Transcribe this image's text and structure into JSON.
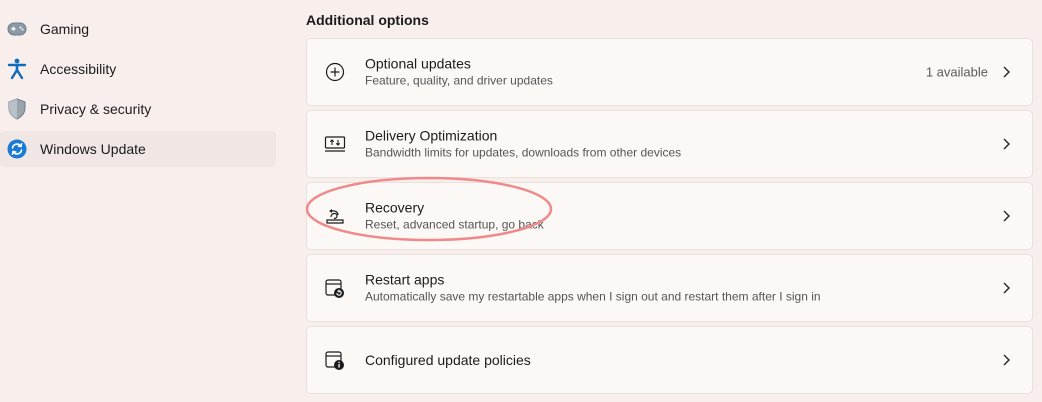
{
  "sidebar": {
    "items": [
      {
        "label": "Gaming",
        "icon": "gamepad-icon"
      },
      {
        "label": "Accessibility",
        "icon": "accessibility-icon"
      },
      {
        "label": "Privacy & security",
        "icon": "shield-icon"
      },
      {
        "label": "Windows Update",
        "icon": "windows-update-icon",
        "selected": true
      }
    ]
  },
  "main": {
    "section_title": "Additional options",
    "cards": [
      {
        "title": "Optional updates",
        "subtitle": "Feature, quality, and driver updates",
        "status": "1 available",
        "icon": "plus-circle-icon"
      },
      {
        "title": "Delivery Optimization",
        "subtitle": "Bandwidth limits for updates, downloads from other devices",
        "icon": "delivery-optimization-icon"
      },
      {
        "title": "Recovery",
        "subtitle": "Reset, advanced startup, go back",
        "icon": "recovery-icon"
      },
      {
        "title": "Restart apps",
        "subtitle": "Automatically save my restartable apps when I sign out and restart them after I sign in",
        "icon": "restart-apps-icon"
      },
      {
        "title": "Configured update policies",
        "subtitle": "",
        "icon": "update-policies-icon"
      }
    ]
  },
  "colors": {
    "background": "#f8efec",
    "card": "#fcf8f6",
    "accent": "#0067c0",
    "highlight_ellipse": "#f08a8a"
  }
}
